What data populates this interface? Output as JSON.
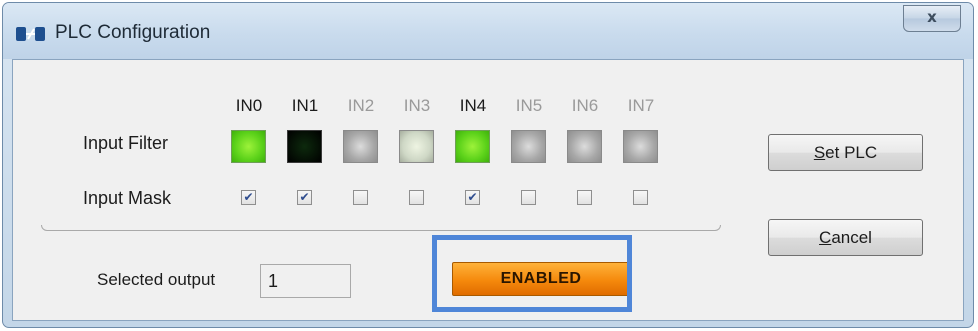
{
  "window": {
    "title": "PLC Configuration",
    "close_label": "x",
    "icon": "plc-app-icon"
  },
  "channels": [
    {
      "label": "IN0",
      "enabled": true,
      "filter": "bright",
      "mask": true
    },
    {
      "label": "IN1",
      "enabled": true,
      "filter": "dark",
      "mask": true
    },
    {
      "label": "IN2",
      "enabled": false,
      "filter": "gray",
      "mask": false
    },
    {
      "label": "IN3",
      "enabled": false,
      "filter": "pale",
      "mask": false
    },
    {
      "label": "IN4",
      "enabled": true,
      "filter": "bright",
      "mask": true
    },
    {
      "label": "IN5",
      "enabled": false,
      "filter": "gray",
      "mask": false
    },
    {
      "label": "IN6",
      "enabled": false,
      "filter": "gray",
      "mask": false
    },
    {
      "label": "IN7",
      "enabled": false,
      "filter": "gray",
      "mask": false
    }
  ],
  "rows": {
    "input_filter": "Input Filter",
    "input_mask": "Input Mask"
  },
  "buttons": {
    "set_plc": {
      "accel": "S",
      "rest": "et PLC"
    },
    "cancel": {
      "accel": "C",
      "rest": "ancel"
    }
  },
  "output": {
    "label": "Selected output",
    "value": "1"
  },
  "status": {
    "text": "ENABLED",
    "color": "#f5890c"
  },
  "colors": {
    "highlight": "#4f86d8",
    "led_on": "#5cd21a"
  }
}
